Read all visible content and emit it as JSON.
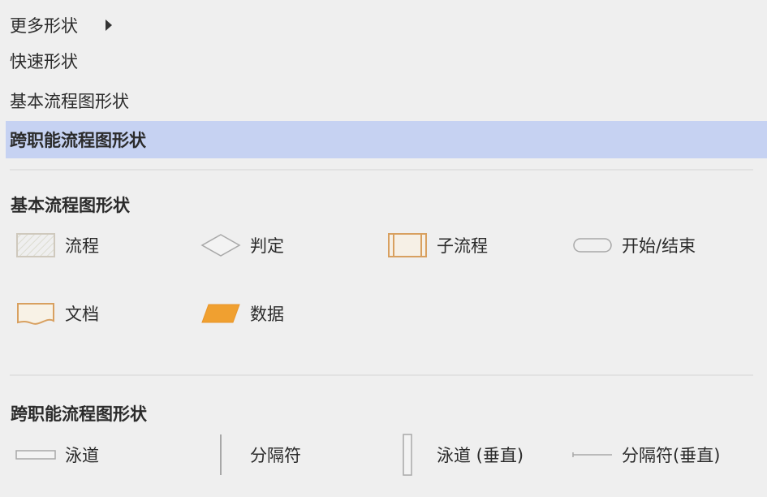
{
  "menu": {
    "items": [
      {
        "label": "更多形状",
        "has_submenu": true,
        "selected": false
      },
      {
        "label": "快速形状",
        "has_submenu": false,
        "selected": false
      },
      {
        "label": "基本流程图形状",
        "has_submenu": false,
        "selected": false
      },
      {
        "label": "跨职能流程图形状",
        "has_submenu": false,
        "selected": true
      }
    ]
  },
  "sections": {
    "basic": {
      "title": "基本流程图形状",
      "shapes": [
        {
          "label": "流程",
          "icon": "process-rect-icon"
        },
        {
          "label": "判定",
          "icon": "decision-diamond-icon"
        },
        {
          "label": "子流程",
          "icon": "subprocess-icon"
        },
        {
          "label": "开始/结束",
          "icon": "terminator-icon"
        },
        {
          "label": "文档",
          "icon": "document-icon"
        },
        {
          "label": "数据",
          "icon": "data-parallelogram-icon"
        }
      ]
    },
    "crossfunc": {
      "title": "跨职能流程图形状",
      "shapes": [
        {
          "label": "泳道",
          "icon": "swimlane-icon"
        },
        {
          "label": "分隔符",
          "icon": "separator-icon"
        },
        {
          "label": "泳道 (垂直)",
          "icon": "swimlane-vertical-icon"
        },
        {
          "label": "分隔符(垂直)",
          "icon": "separator-vertical-icon"
        }
      ]
    }
  },
  "colors": {
    "selected_bg": "#c6d2f2",
    "orange_accent": "#f0a030",
    "gray_stroke": "#a8a8a8"
  }
}
